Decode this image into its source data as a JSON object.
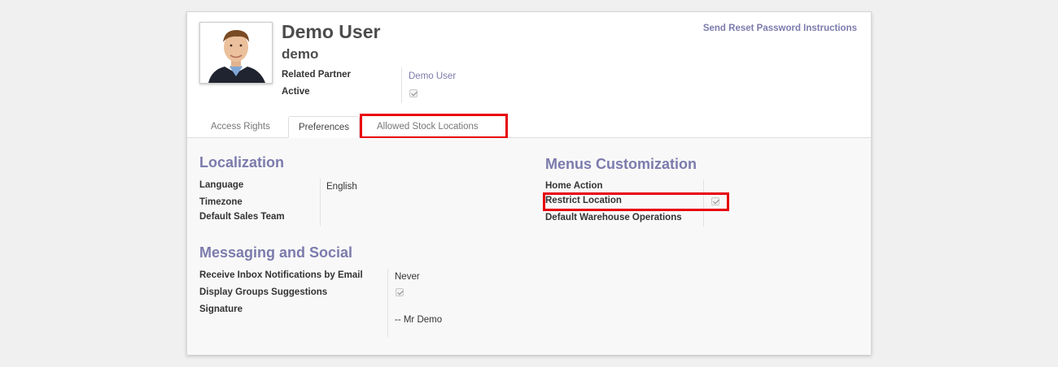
{
  "header": {
    "send_reset": "Send Reset Password Instructions",
    "name": "Demo User",
    "login": "demo",
    "related_partner_label": "Related Partner",
    "related_partner_value": "Demo User",
    "active_label": "Active",
    "active_checked": true
  },
  "tabs": [
    {
      "label": "Access Rights",
      "active": false
    },
    {
      "label": "Preferences",
      "active": true
    },
    {
      "label": "Allowed Stock Locations",
      "active": false
    }
  ],
  "localization": {
    "title": "Localization",
    "language_label": "Language",
    "language_value": "English",
    "timezone_label": "Timezone",
    "sales_team_label": "Default Sales Team"
  },
  "menus": {
    "title": "Menus Customization",
    "home_action_label": "Home Action",
    "restrict_location_label": "Restrict Location",
    "restrict_location_checked": true,
    "warehouse_ops_label": "Default Warehouse Operations"
  },
  "messaging": {
    "title": "Messaging and Social",
    "inbox_label": "Receive Inbox Notifications by Email",
    "inbox_value": "Never",
    "groups_label": "Display Groups Suggestions",
    "groups_checked": true,
    "signature_label": "Signature",
    "signature_value": "-- Mr Demo"
  },
  "colors": {
    "accent": "#7c7bad",
    "highlight": "#e8000b"
  }
}
